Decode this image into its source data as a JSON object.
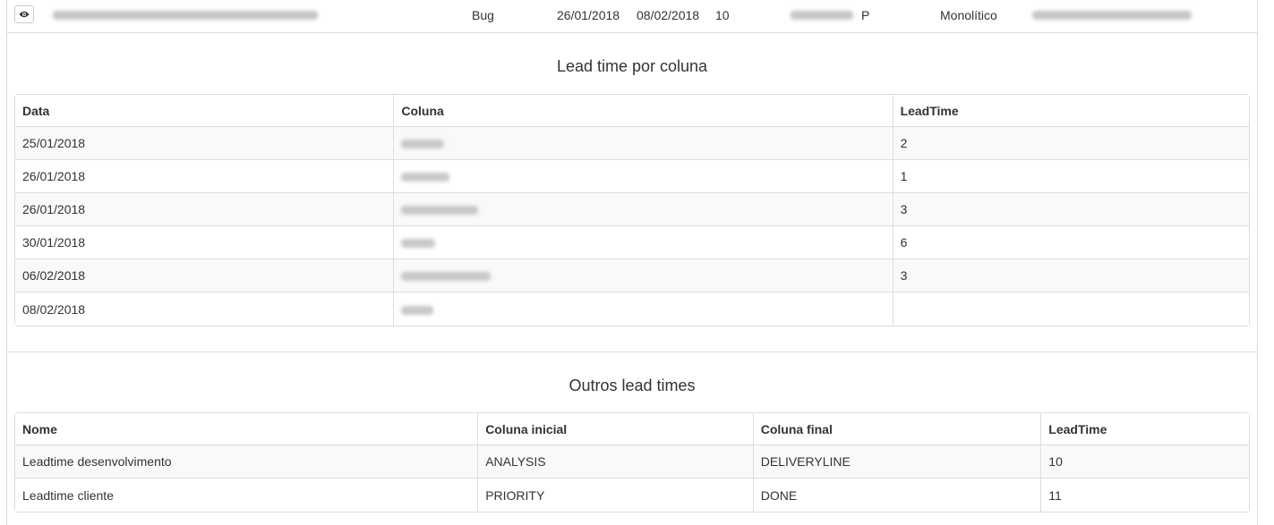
{
  "summary_row": {
    "type": "Bug",
    "start_date": "26/01/2018",
    "end_date": "08/02/2018",
    "lead_time": "10",
    "size": "P",
    "system": "Monolítico"
  },
  "lead_time_por_coluna": {
    "title": "Lead time por coluna",
    "columns": [
      "Data",
      "Coluna",
      "LeadTime"
    ],
    "rows": [
      {
        "data": "25/01/2018",
        "leadtime": "2"
      },
      {
        "data": "26/01/2018",
        "leadtime": "1"
      },
      {
        "data": "26/01/2018",
        "leadtime": "3"
      },
      {
        "data": "30/01/2018",
        "leadtime": "6"
      },
      {
        "data": "06/02/2018",
        "leadtime": "3"
      },
      {
        "data": "08/02/2018",
        "leadtime": ""
      }
    ]
  },
  "outros_lead_times": {
    "title": "Outros lead times",
    "columns": [
      "Nome",
      "Coluna inicial",
      "Coluna final",
      "LeadTime"
    ],
    "rows": [
      {
        "nome": "Leadtime desenvolvimento",
        "inicial": "ANALYSIS",
        "final": "DELIVERYLINE",
        "leadtime": "10"
      },
      {
        "nome": "Leadtime cliente",
        "inicial": "PRIORITY",
        "final": "DONE",
        "leadtime": "11"
      }
    ]
  },
  "icons": {
    "view": "eye-icon"
  },
  "colors": {
    "border": "#dddddd",
    "stripe": "#f9f9f9",
    "text": "#333333"
  }
}
